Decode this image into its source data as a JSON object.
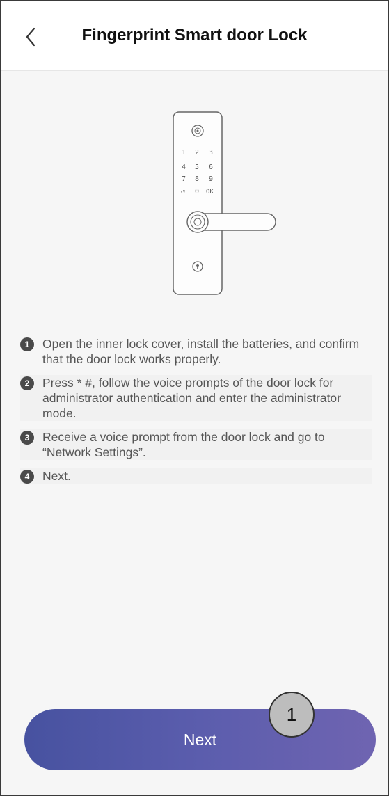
{
  "header": {
    "title": "Fingerprint Smart door Lock",
    "back_icon": "chevron-left-icon"
  },
  "illustration": {
    "keypad": [
      "1",
      "2",
      "3",
      "4",
      "5",
      "6",
      "7",
      "8",
      "9",
      "↺",
      "0",
      "OK"
    ]
  },
  "steps": [
    {
      "num": "1",
      "text": "Open the inner lock cover, install the batteries, and confirm that the door lock works properly."
    },
    {
      "num": "2",
      "text": "Press * #, follow the voice prompts of the door lock for administrator authentication and enter the administrator mode."
    },
    {
      "num": "3",
      "text": "Receive a voice prompt from the door lock and go to “Network Settings”."
    },
    {
      "num": "4",
      "text": "Next."
    }
  ],
  "next_button": {
    "label": "Next"
  },
  "annotation": {
    "label": "1"
  }
}
